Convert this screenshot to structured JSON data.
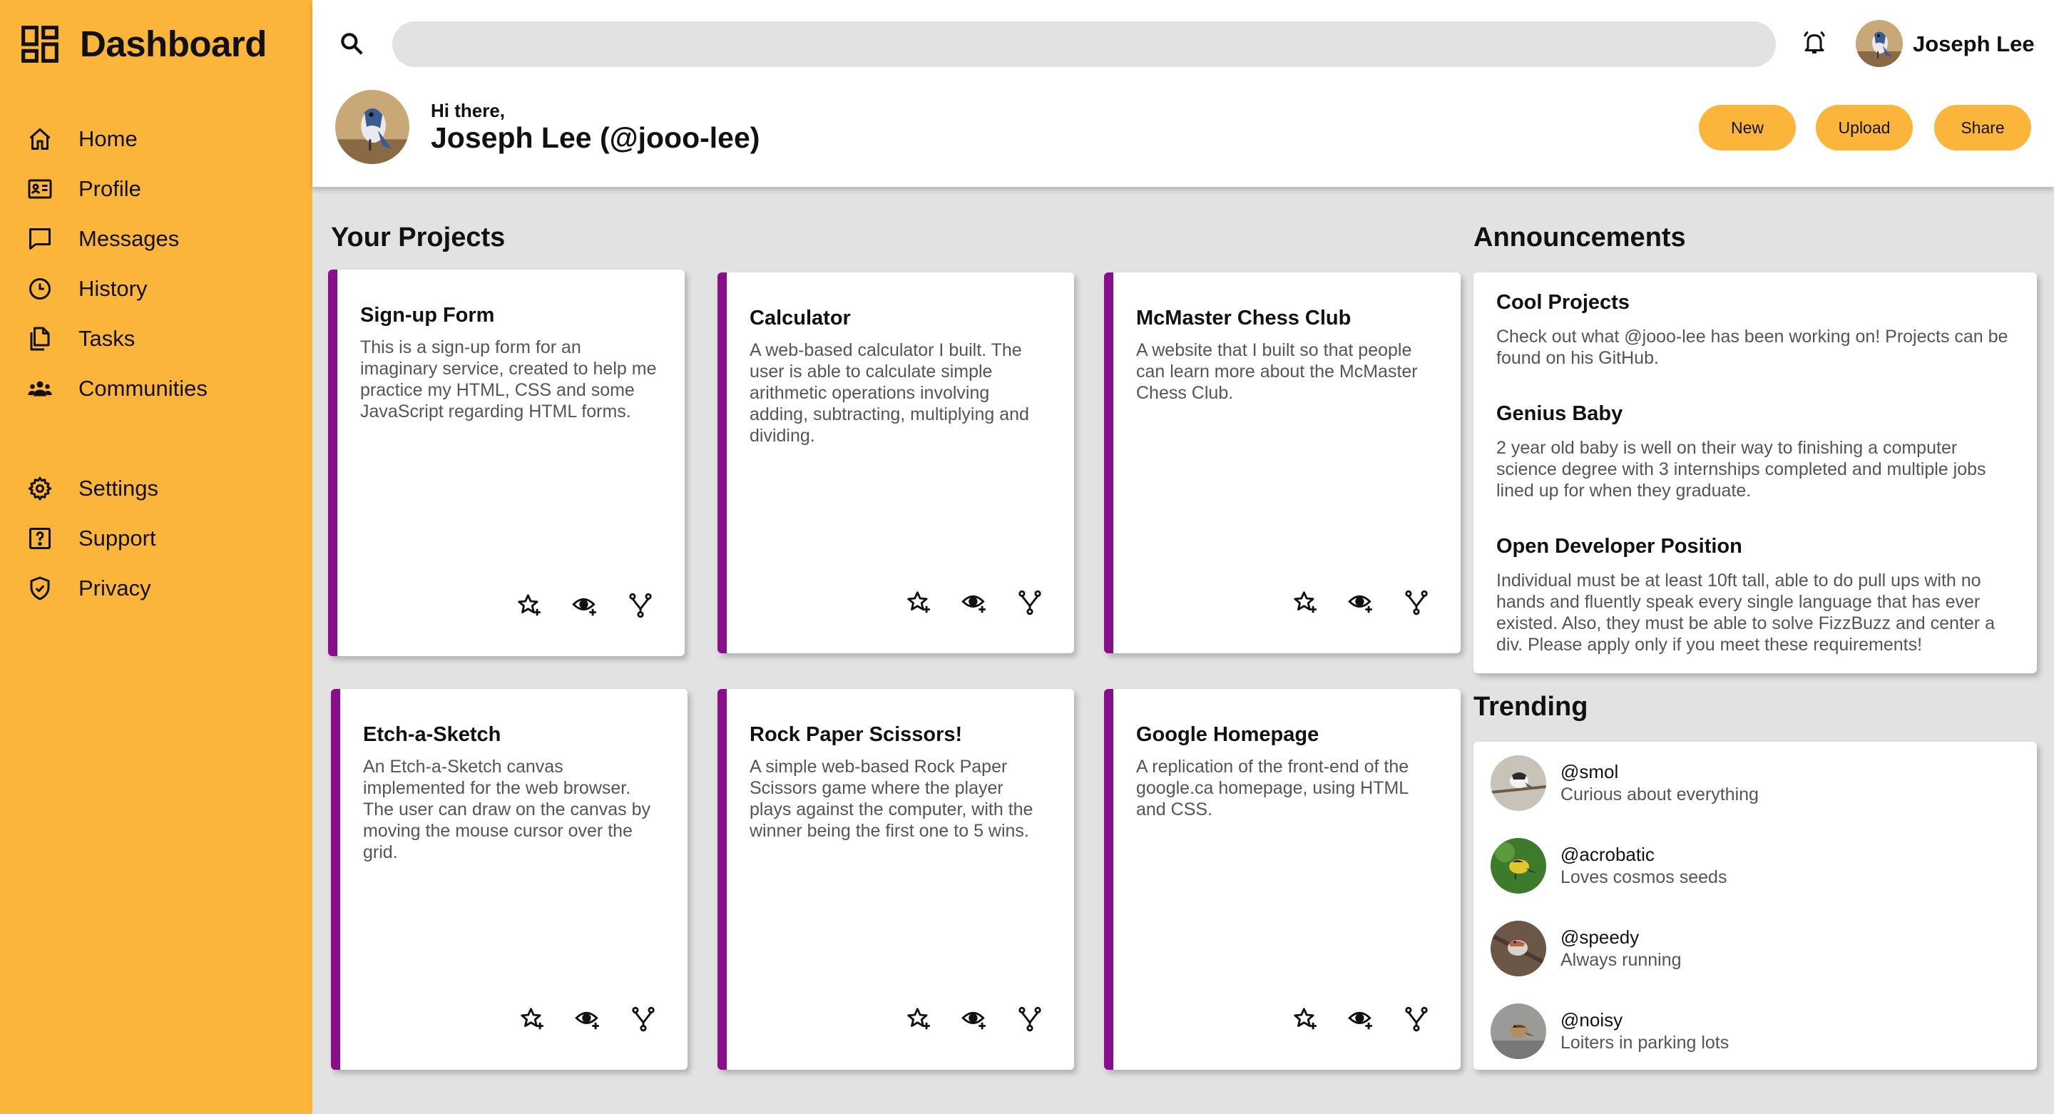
{
  "app": {
    "title": "Dashboard"
  },
  "sidebar": {
    "items": [
      {
        "label": "Home",
        "icon": "home-icon"
      },
      {
        "label": "Profile",
        "icon": "id-card-icon"
      },
      {
        "label": "Messages",
        "icon": "chat-icon"
      },
      {
        "label": "History",
        "icon": "clock-icon"
      },
      {
        "label": "Tasks",
        "icon": "documents-icon"
      },
      {
        "label": "Communities",
        "icon": "people-icon"
      }
    ],
    "bottom_items": [
      {
        "label": "Settings",
        "icon": "gear-icon"
      },
      {
        "label": "Support",
        "icon": "help-icon"
      },
      {
        "label": "Privacy",
        "icon": "shield-icon"
      }
    ]
  },
  "header": {
    "search": {
      "value": "",
      "placeholder": ""
    },
    "username": "Joseph Lee",
    "greeting": "Hi there,",
    "full_name": "Joseph Lee (@jooo-lee)",
    "buttons": {
      "new": "New",
      "upload": "Upload",
      "share": "Share"
    }
  },
  "projects": {
    "title": "Your Projects",
    "items": [
      {
        "title": "Sign-up Form",
        "description": "This is a sign-up form for an imaginary service, created to help me practice my HTML, CSS and some JavaScript regarding HTML forms."
      },
      {
        "title": "Calculator",
        "description": "A web-based calculator I built. The user is able to calculate simple arithmetic operations involving adding, subtracting, multiplying and dividing."
      },
      {
        "title": "McMaster Chess Club",
        "description": "A website that I built so that people can learn more about the McMaster Chess Club."
      },
      {
        "title": "Etch-a-Sketch",
        "description": "An Etch-a-Sketch canvas implemented for the web browser. The user can draw on the canvas by moving the mouse cursor over the grid."
      },
      {
        "title": "Rock Paper Scissors!",
        "description": "A simple web-based Rock Paper Scissors game where the player plays against the computer, with the winner being the first one to 5 wins."
      },
      {
        "title": "Google Homepage",
        "description": "A replication of the front-end of the google.ca homepage, using HTML and CSS."
      }
    ]
  },
  "announcements": {
    "title": "Announcements",
    "items": [
      {
        "title": "Cool Projects",
        "body": "Check out what @jooo-lee has been working on! Projects can be found on his GitHub."
      },
      {
        "title": "Genius Baby",
        "body": "2 year old baby is well on their way to finishing a computer science degree with 3 internships completed and multiple jobs lined up for when they graduate."
      },
      {
        "title": "Open Developer Position",
        "body": "Individual must be at least 10ft tall, able to do pull ups with no hands and fluently speak every single language that has ever existed. Also, they must be able to solve FizzBuzz and center a div. Please apply only if you meet these requirements!"
      }
    ]
  },
  "trending": {
    "title": "Trending",
    "items": [
      {
        "handle": "@smol",
        "description": "Curious about everything"
      },
      {
        "handle": "@acrobatic",
        "description": "Loves cosmos seeds"
      },
      {
        "handle": "@speedy",
        "description": "Always running"
      },
      {
        "handle": "@noisy",
        "description": "Loiters in parking lots"
      }
    ]
  },
  "colors": {
    "accent": "#fcb53b",
    "card_border": "#880e8a",
    "background": "#e2e2e2"
  }
}
